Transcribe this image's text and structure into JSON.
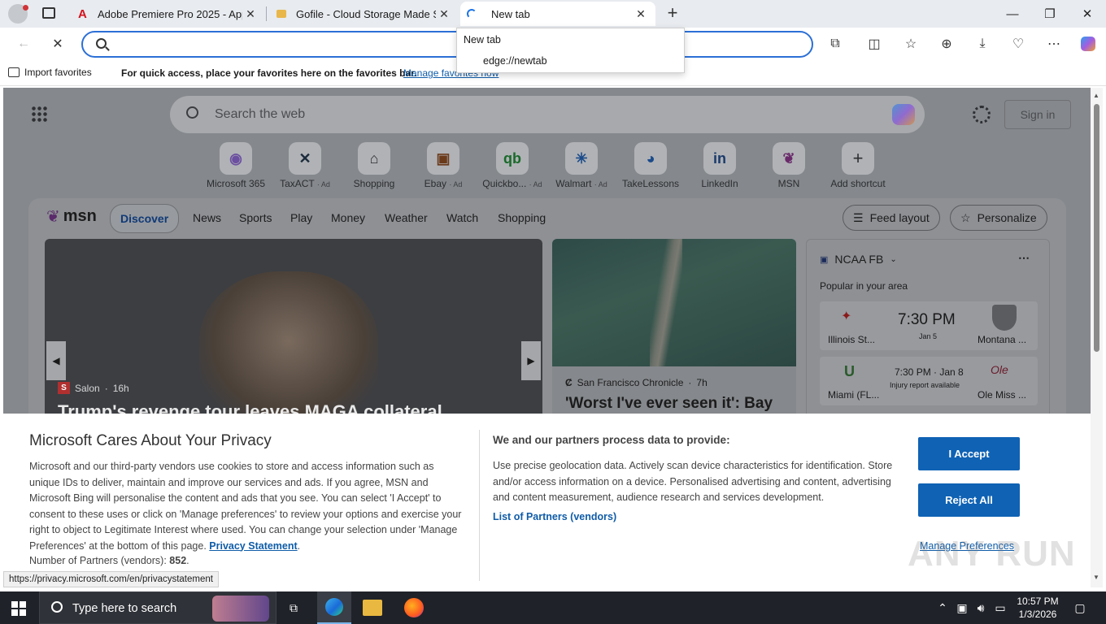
{
  "tabs": [
    {
      "title": "Adobe Premiere Pro 2025 - AppD",
      "icon": "adobe-icon"
    },
    {
      "title": "Gofile - Cloud Storage Made Simp",
      "icon": "gofile-icon"
    },
    {
      "title": "New tab",
      "icon": "loading-icon"
    }
  ],
  "dropdown": {
    "header": "New tab",
    "url": "edge://newtab"
  },
  "favbar": {
    "import": "Import favorites",
    "message": "For quick access, place your favorites here on the favorites bar.",
    "manage": "Manage favorites now"
  },
  "newtab": {
    "search_placeholder": "Search the web",
    "sign_in": "Sign in",
    "shortcuts": [
      {
        "label": "Microsoft 365",
        "ad": ""
      },
      {
        "label": "TaxACT",
        "ad": "· Ad"
      },
      {
        "label": "Shopping",
        "ad": ""
      },
      {
        "label": "Ebay",
        "ad": "· Ad"
      },
      {
        "label": "Quickbo...",
        "ad": "· Ad"
      },
      {
        "label": "Walmart",
        "ad": "· Ad"
      },
      {
        "label": "TakeLessons",
        "ad": ""
      },
      {
        "label": "LinkedIn",
        "ad": ""
      },
      {
        "label": "MSN",
        "ad": ""
      },
      {
        "label": "Add shortcut",
        "ad": ""
      }
    ]
  },
  "msn": {
    "logo": "msn",
    "nav": [
      "Discover",
      "News",
      "Sports",
      "Play",
      "Money",
      "Weather",
      "Watch",
      "Shopping"
    ],
    "feed_layout": "Feed layout",
    "personalize": "Personalize",
    "hero": {
      "source": "Salon",
      "age": "16h",
      "headline": "Trump's revenge tour leaves MAGA collateral"
    },
    "second": {
      "source": "San Francisco Chronicle",
      "age": "7h",
      "headline": "'Worst I've ever seen it': Bay"
    },
    "sports": {
      "league": "NCAA FB",
      "subtitle": "Popular in your area",
      "games": [
        {
          "home": "Illinois St...",
          "away": "Montana ...",
          "time": "7:30 PM",
          "date": "Jan 5",
          "note": ""
        },
        {
          "home": "Miami (FL...",
          "away": "Ole Miss ...",
          "time": "7:30 PM · Jan 8",
          "date": "",
          "note": "Injury report available"
        }
      ]
    }
  },
  "privacy": {
    "title": "Microsoft Cares About Your Privacy",
    "body": "Microsoft and our third-party vendors use cookies to store and access information such as unique IDs to deliver, maintain and improve our services and ads. If you agree, MSN and Microsoft Bing will personalise the content and ads that you see. You can select 'I Accept' to consent to these uses or click on 'Manage preferences' to review your options and exercise your right to object to Legitimate Interest where used.  You can change your selection under 'Manage Preferences' at the bottom of this page.",
    "privacy_link": "Privacy Statement",
    "partners_label": "Number of Partners (vendors):",
    "partners_count": "852",
    "provide_title": "We and our partners process data to provide:",
    "provide_body": "Use precise geolocation data. Actively scan device characteristics for identification. Store and/or access information on a device. Personalised advertising and content, advertising and content measurement, audience research and services development.",
    "partners_link": "List of Partners (vendors)",
    "accept": "I Accept",
    "reject": "Reject All",
    "manage": "Manage Preferences"
  },
  "status_url": "https://privacy.microsoft.com/en/privacystatement",
  "watermark": "ANY RUN",
  "taskbar": {
    "search": "Type here to search",
    "time": "10:57 PM",
    "date": "1/3/2026"
  },
  "colors": {
    "accent": "#0f62b4",
    "address_border": "#2b6fd6",
    "taskbar": "#1f2228"
  }
}
